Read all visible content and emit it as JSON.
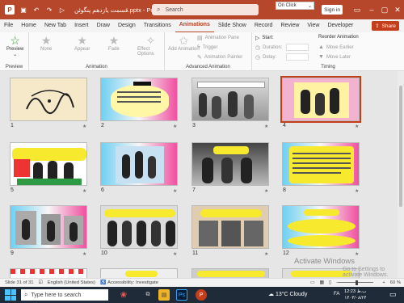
{
  "titlebar": {
    "app_letter": "P",
    "doc_title": "قسمت یازدهم پنگوئن.pptx  -  PowerPoint",
    "search_placeholder": "Search",
    "signin_label": "Sign in"
  },
  "menu": {
    "tabs": [
      "File",
      "Home",
      "New Tab",
      "Insert",
      "Draw",
      "Design",
      "Transitions",
      "Animations",
      "Slide Show",
      "Record",
      "Review",
      "View",
      "Developer"
    ],
    "active": "Animations",
    "share_label": "Share"
  },
  "ribbon": {
    "preview_label": "Preview",
    "preview_group": "Preview",
    "animation_group": "Animation",
    "effects": [
      "None",
      "Appear",
      "Fade"
    ],
    "effect_options": "Effect Options",
    "add_animation": "Add Animation",
    "advanced_group": "Advanced Animation",
    "advanced_items": [
      "Animation Pane",
      "Trigger",
      "Animation Painter"
    ],
    "timing_group": "Timing",
    "start_label": "Start:",
    "start_value": "On Click",
    "duration_label": "Duration:",
    "delay_label": "Delay:",
    "reorder_title": "Reorder Animation",
    "move_earlier": "Move Earlier",
    "move_later": "Move Later"
  },
  "slides": {
    "numbers": [
      "1",
      "2",
      "3",
      "4",
      "5",
      "6",
      "7",
      "8",
      "9",
      "10",
      "11",
      "12"
    ],
    "selected": "4"
  },
  "watermark": {
    "line1": "Activate Windows",
    "line2": "Go to Settings to activate Windows."
  },
  "status": {
    "slide": "Slide 31 of 31",
    "language": "English (United States)",
    "accessibility": "Accessibility: Investigate",
    "zoom": "60 %"
  },
  "taskbar": {
    "search_placeholder": "Type here to search",
    "weather": "13°C  Cloudy",
    "time": "12:23 ب.ظ",
    "date": "۱۴۰۳/۰۸/۲۴",
    "lang": "FA"
  },
  "colors": {
    "accent": "#b7472a",
    "share": "#c43e1c",
    "taskbar": "#1f2b38"
  }
}
